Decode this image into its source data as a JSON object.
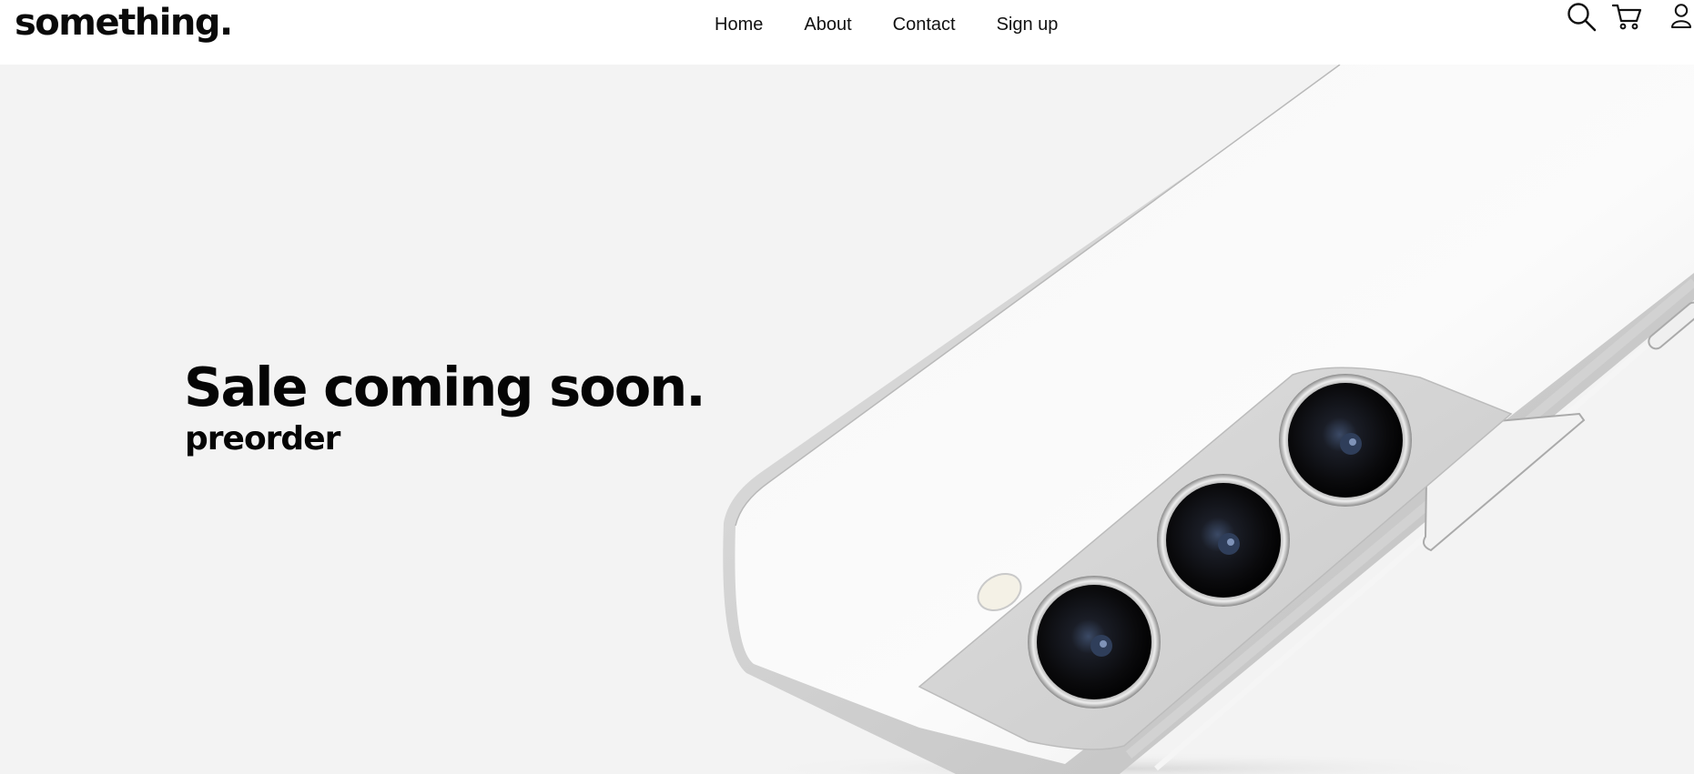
{
  "header": {
    "logo": "something.",
    "nav": [
      {
        "label": "Home"
      },
      {
        "label": "About"
      },
      {
        "label": "Contact"
      },
      {
        "label": "Sign up"
      }
    ],
    "icons": [
      "search-icon",
      "cart-icon",
      "user-icon"
    ]
  },
  "hero": {
    "headline": "Sale coming soon.",
    "subheadline": "preorder",
    "image": "phone-back-camera-image"
  },
  "colors": {
    "background": "#f3f3f3",
    "header_background": "#ffffff",
    "text": "#050505"
  }
}
